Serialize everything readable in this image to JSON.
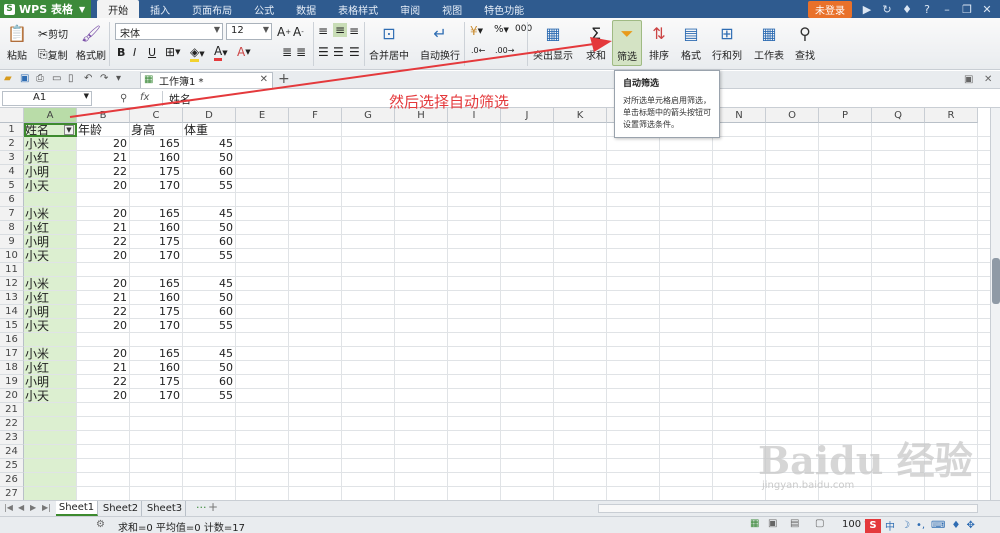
{
  "app": {
    "name": "WPS 表格",
    "logo": "S"
  },
  "menu": {
    "tabs": [
      "开始",
      "插入",
      "页面布局",
      "公式",
      "数据",
      "表格样式",
      "审阅",
      "视图",
      "特色功能"
    ],
    "login": "未登录"
  },
  "ribbon": {
    "paste": "粘贴",
    "cut": "剪切",
    "copy": "复制",
    "format_painter": "格式刷",
    "font_name": "宋体",
    "font_size": "12",
    "bold": "B",
    "italic": "I",
    "underline": "U",
    "merge_center": "合并居中",
    "wrap_text": "自动换行",
    "number_format_pct": "%",
    "number_format_000": "000",
    "highlight": "突出显示",
    "sum": "求和",
    "filter": "筛选",
    "sort": "排序",
    "format": "格式",
    "rows_cols": "行和列",
    "worksheet": "工作表",
    "find": "查找"
  },
  "tooltip": {
    "title": "自动筛选",
    "body": "对所选单元格启用筛选，单击标题中的箭头按钮可设置筛选条件。"
  },
  "document": {
    "tab_name": "工作簿1 *"
  },
  "formula_bar": {
    "name_box": "A1",
    "fx": "fx",
    "content": "姓名"
  },
  "annotation": "然后选择自动筛选",
  "columns": [
    "A",
    "B",
    "C",
    "D",
    "E",
    "F",
    "G",
    "H",
    "I",
    "J",
    "K",
    "L",
    "M",
    "N",
    "O",
    "P",
    "Q",
    "R"
  ],
  "rows": [
    [
      "姓名",
      "年龄",
      "身高",
      "体重"
    ],
    [
      "小米",
      "20",
      "165",
      "45"
    ],
    [
      "小红",
      "21",
      "160",
      "50"
    ],
    [
      "小明",
      "22",
      "175",
      "60"
    ],
    [
      "小天",
      "20",
      "170",
      "55"
    ],
    [
      "",
      "",
      "",
      ""
    ],
    [
      "小米",
      "20",
      "165",
      "45"
    ],
    [
      "小红",
      "21",
      "160",
      "50"
    ],
    [
      "小明",
      "22",
      "175",
      "60"
    ],
    [
      "小天",
      "20",
      "170",
      "55"
    ],
    [
      "",
      "",
      "",
      ""
    ],
    [
      "小米",
      "20",
      "165",
      "45"
    ],
    [
      "小红",
      "21",
      "160",
      "50"
    ],
    [
      "小明",
      "22",
      "175",
      "60"
    ],
    [
      "小天",
      "20",
      "170",
      "55"
    ],
    [
      "",
      "",
      "",
      ""
    ],
    [
      "小米",
      "20",
      "165",
      "45"
    ],
    [
      "小红",
      "21",
      "160",
      "50"
    ],
    [
      "小明",
      "22",
      "175",
      "60"
    ],
    [
      "小天",
      "20",
      "170",
      "55"
    ],
    [
      "",
      "",
      "",
      ""
    ],
    [
      "",
      "",
      "",
      ""
    ],
    [
      "",
      "",
      "",
      ""
    ],
    [
      "",
      "",
      "",
      ""
    ],
    [
      "",
      "",
      "",
      ""
    ],
    [
      "",
      "",
      "",
      ""
    ],
    [
      "",
      "",
      "",
      ""
    ]
  ],
  "sheets": [
    "Sheet1",
    "Sheet2",
    "Sheet3"
  ],
  "status": {
    "text": "求和=0  平均值=0  计数=17",
    "zoom": "100 %"
  },
  "ime": {
    "logo": "S",
    "mode": "中"
  },
  "watermark": {
    "main": "Baidu 经验",
    "url": "jingyan.baidu.com"
  },
  "colors": {
    "accent_green": "#3c8a3a",
    "menubar": "#2f5b8f",
    "annotation_red": "#e4393c",
    "login_orange": "#e9712a"
  }
}
